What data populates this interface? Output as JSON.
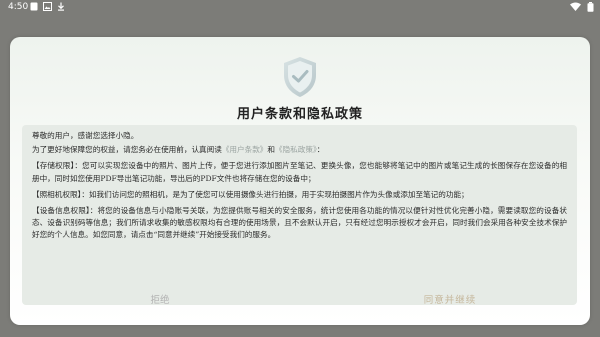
{
  "status_bar": {
    "time": "4:50",
    "icons_left": [
      "square-icon",
      "image-icon",
      "download-icon"
    ],
    "icons_right": [
      "wifi-icon",
      "battery-icon"
    ]
  },
  "dialog": {
    "title": "用户条款和隐私政策",
    "greeting": "尊敬的用户，感谢您选择小隐。",
    "intro_before": "为了更好地保障您的权益，请您务必在使用前，认真阅读",
    "link_terms": "《用户条款》",
    "intro_and": "和",
    "link_privacy": "《隐私政策》",
    "intro_after": "：",
    "storage_permission": "【存储权限】：您可以实现您设备中的照片、图片上传，便于您进行添加图片至笔记、更换头像，您也能够将笔记中的图片或笔记生成的长图保存在您设备的相册中，同时如您使用PDF导出笔记功能，导出后的PDF文件也将存储在您的设备中；",
    "camera_permission": "【照相机权限】：如我们访问您的照相机，是为了使您可以使用摄像头进行拍摄，用于实现拍摄图片作为头像或添加至笔记的功能；",
    "device_permission": "【设备信息权限】：将您的设备信息与小隐账号关联，为您提供账号相关的安全服务，统计您使用各功能的情况以便针对性优化完善小隐，需要读取您的设备状态、设备识别码等信息；我们所请求收集的敏感权限均有合理的使用场景，且不会默认开启，只有经过您明示授权才会开启，同时我们会采用各种安全技术保护好您的个人信息。如您同意，请点击“同意并继续”开始接受我们的服务。",
    "reject_label": "拒绝",
    "agree_label": "同意并继续"
  },
  "colors": {
    "scrim": "#7c7c78",
    "content_bg": "#e6ebe6",
    "agree_text": "#c5b79c",
    "reject_text": "#b3b3b3",
    "link_text": "#9aa3a0"
  }
}
